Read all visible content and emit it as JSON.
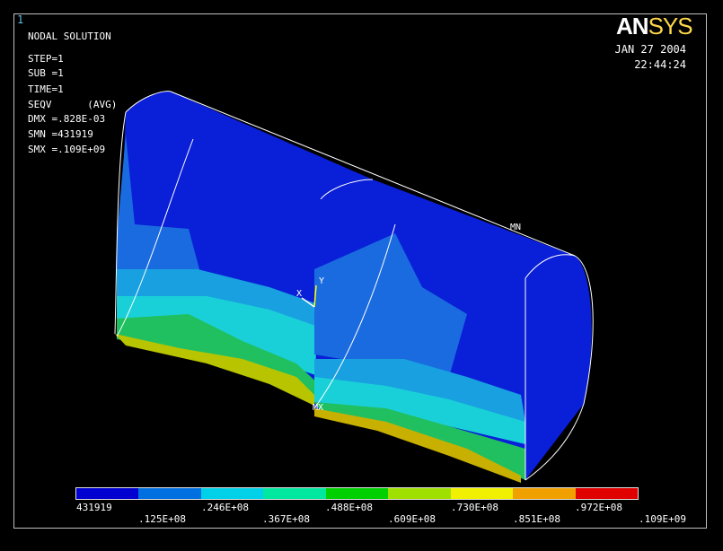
{
  "window_number": "1",
  "header": {
    "title": "NODAL SOLUTION",
    "lines": [
      "STEP=1",
      "SUB =1",
      "TIME=1",
      "SEQV      (AVG)",
      "DMX =.828E-03",
      "SMN =431919",
      "SMX =.109E+09"
    ]
  },
  "date": "JAN 27 2004",
  "time": "22:44:24",
  "logo": {
    "part1": "AN",
    "part2": "SYS"
  },
  "markers": {
    "min": "MN",
    "max": "MX",
    "axis_x": "X",
    "axis_y": "Y"
  },
  "legend": {
    "colors": [
      "#0000d0",
      "#0070e0",
      "#00d0e8",
      "#00e8a0",
      "#00d000",
      "#a0e000",
      "#f0f000",
      "#f0a000",
      "#e00000"
    ],
    "labels_row1": [
      "431919",
      ".246E+08",
      ".488E+08",
      ".730E+08",
      ".972E+08"
    ],
    "labels_row2": [
      ".125E+08",
      ".367E+08",
      ".609E+08",
      ".851E+08",
      ".109E+09"
    ]
  }
}
